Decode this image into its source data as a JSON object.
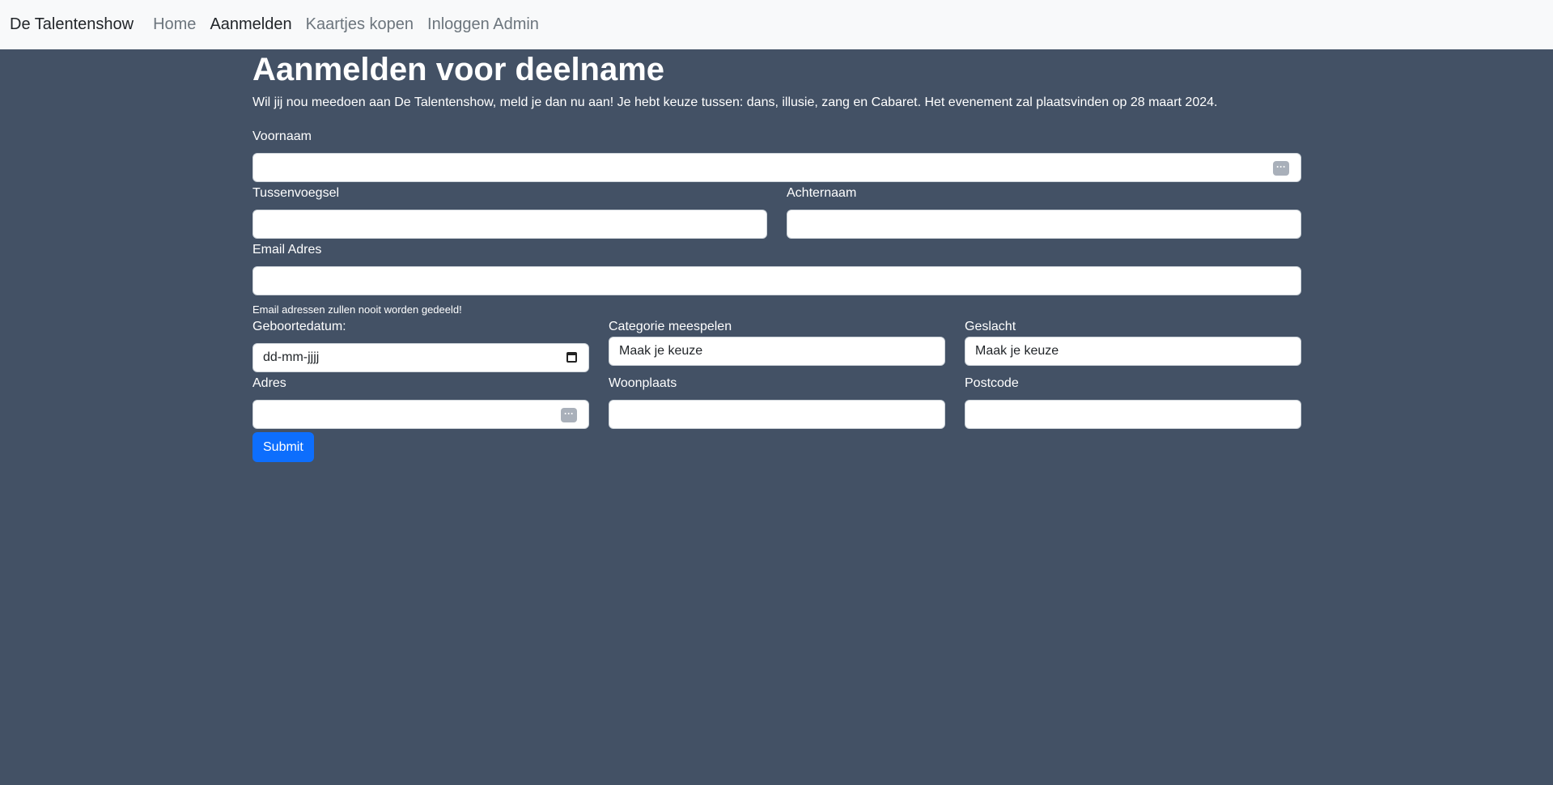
{
  "navbar": {
    "brand": "De Talentenshow",
    "items": [
      {
        "label": "Home"
      },
      {
        "label": "Aanmelden"
      },
      {
        "label": "Kaartjes kopen"
      },
      {
        "label": "Inloggen Admin"
      }
    ]
  },
  "page": {
    "title": "Aanmelden voor deelname",
    "intro": "Wil jij nou meedoen aan De Talentenshow, meld je dan nu aan! Je hebt keuze tussen: dans, illusie, zang en Cabaret. Het evenement zal plaatsvinden op 28 maart 2024."
  },
  "form": {
    "voornaam": {
      "label": "Voornaam",
      "value": ""
    },
    "tussenvoegsel": {
      "label": "Tussenvoegsel",
      "value": ""
    },
    "achternaam": {
      "label": "Achternaam",
      "value": ""
    },
    "email": {
      "label": "Email Adres",
      "value": "",
      "help": "Email adressen zullen nooit worden gedeeld!"
    },
    "geboortedatum": {
      "label": "Geboortedatum:",
      "placeholder": "dd-mm-jjjj"
    },
    "categorie": {
      "label": "Categorie meespelen",
      "selected": "Maak je keuze"
    },
    "geslacht": {
      "label": "Geslacht",
      "selected": "Maak je keuze"
    },
    "adres": {
      "label": "Adres",
      "value": ""
    },
    "woonplaats": {
      "label": "Woonplaats",
      "value": ""
    },
    "postcode": {
      "label": "Postcode",
      "value": ""
    },
    "submit_label": "Submit"
  },
  "colors": {
    "background": "#435165",
    "navbar": "#f8f9fa",
    "primary": "#0d6efd"
  },
  "icons": {
    "autofill": "more-dots-icon",
    "date": "calendar-icon"
  }
}
